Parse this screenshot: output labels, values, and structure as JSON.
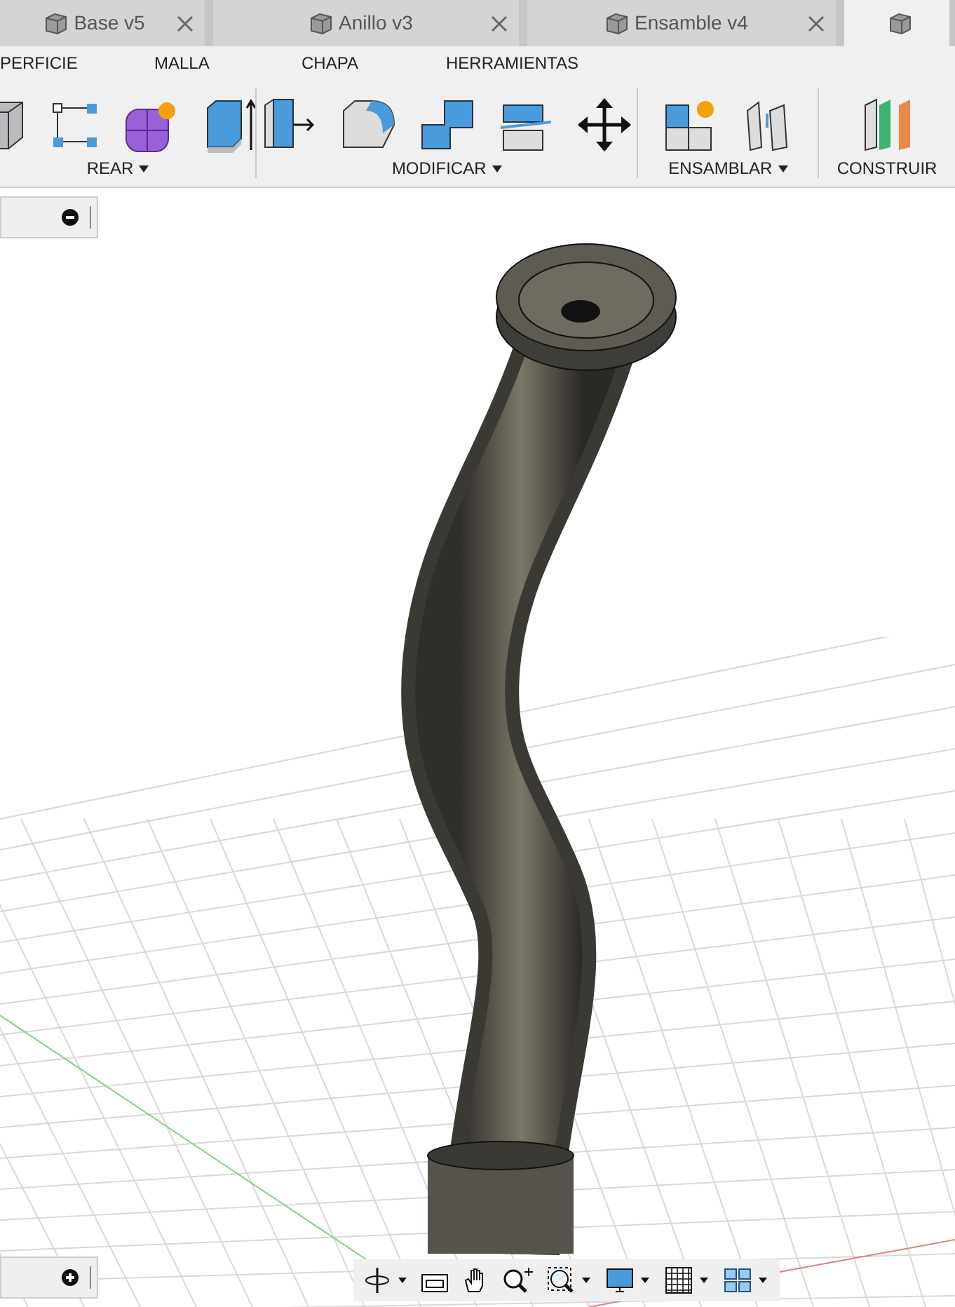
{
  "tabs": [
    {
      "label": "Base v5",
      "selected": false
    },
    {
      "label": "Anillo v3",
      "selected": false
    },
    {
      "label": "Ensamble v4",
      "selected": false
    },
    {
      "selected": true
    }
  ],
  "menu": [
    "PERFICIE",
    "MALLA",
    "CHAPA",
    "HERRAMIENTAS"
  ],
  "tool_groups": [
    {
      "label": "REAR",
      "dropdown": true
    },
    {
      "label": "MODIFICAR",
      "dropdown": true
    },
    {
      "label": "ENSAMBLAR",
      "dropdown": true
    },
    {
      "label": "CONSTRUIR",
      "dropdown": false
    }
  ]
}
